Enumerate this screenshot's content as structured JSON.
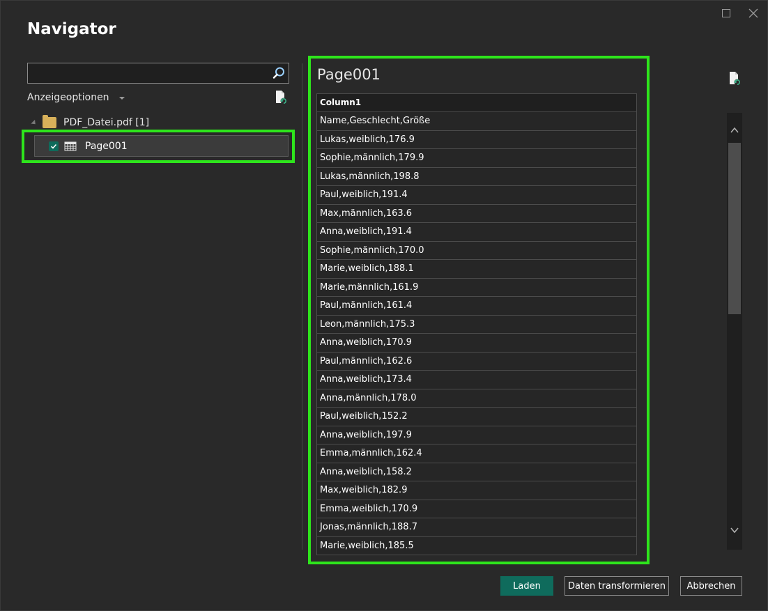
{
  "dialog": {
    "title": "Navigator"
  },
  "left": {
    "search": {
      "value": "",
      "placeholder": ""
    },
    "options_label": "Anzeigeoptionen",
    "tree": {
      "folder_label": "PDF_Datei.pdf [1]",
      "item_label": "Page001",
      "item_checked": true
    }
  },
  "preview": {
    "title": "Page001",
    "column_header": "Column1",
    "rows": [
      "Name,Geschlecht,Größe",
      "Lukas,weiblich,176.9",
      "Sophie,männlich,179.9",
      "Lukas,männlich,198.8",
      "Paul,weiblich,191.4",
      "Max,männlich,163.6",
      "Anna,weiblich,191.4",
      "Sophie,männlich,170.0",
      "Marie,weiblich,188.1",
      "Marie,männlich,161.9",
      "Paul,männlich,161.4",
      "Leon,männlich,175.3",
      "Anna,weiblich,170.9",
      "Paul,männlich,162.6",
      "Anna,weiblich,173.4",
      "Anna,männlich,178.0",
      "Paul,weiblich,152.2",
      "Anna,weiblich,197.9",
      "Emma,männlich,162.4",
      "Anna,weiblich,158.2",
      "Max,weiblich,182.9",
      "Emma,weiblich,170.9",
      "Jonas,männlich,188.7",
      "Marie,weiblich,185.5"
    ]
  },
  "buttons": {
    "load": "Laden",
    "transform": "Daten transformieren",
    "cancel": "Abbrechen"
  },
  "colors": {
    "highlight": "#2ee51c",
    "primary_button": "#0f6b5c"
  }
}
